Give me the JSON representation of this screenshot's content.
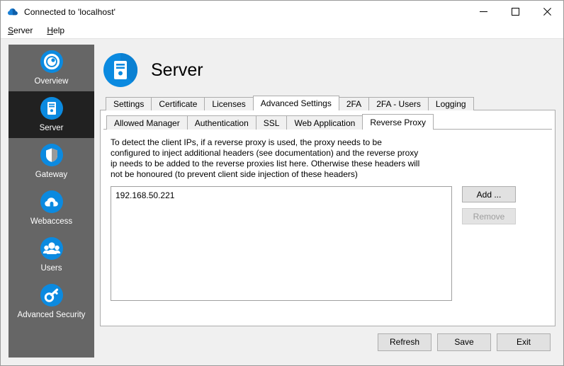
{
  "window": {
    "title": "Connected to 'localhost'",
    "title_icon": "cloud-icon",
    "controls": {
      "minimize": "minimize-icon",
      "maximize": "maximize-icon",
      "close": "close-icon"
    }
  },
  "menubar": {
    "items": [
      {
        "label": "Server",
        "mnemonic": "S",
        "rest": "erver"
      },
      {
        "label": "Help",
        "mnemonic": "H",
        "rest": "elp"
      }
    ]
  },
  "sidebar": {
    "items": [
      {
        "label": "Overview",
        "icon": "overview-circle-icon",
        "active": false
      },
      {
        "label": "Server",
        "icon": "server-tower-icon",
        "active": true
      },
      {
        "label": "Gateway",
        "icon": "shield-icon",
        "active": false
      },
      {
        "label": "Webaccess",
        "icon": "cloud-icon",
        "active": false
      },
      {
        "label": "Users",
        "icon": "users-icon",
        "active": false
      },
      {
        "label": "Advanced Security",
        "icon": "key-icon",
        "active": false
      }
    ]
  },
  "page": {
    "title": "Server",
    "icon": "server-tower-icon"
  },
  "tabs_primary": {
    "items": [
      {
        "label": "Settings",
        "selected": false
      },
      {
        "label": "Certificate",
        "selected": false
      },
      {
        "label": "Licenses",
        "selected": false
      },
      {
        "label": "Advanced Settings",
        "selected": true
      },
      {
        "label": "2FA",
        "selected": false
      },
      {
        "label": "2FA - Users",
        "selected": false
      },
      {
        "label": "Logging",
        "selected": false
      }
    ]
  },
  "tabs_secondary": {
    "items": [
      {
        "label": "Allowed Manager",
        "selected": false
      },
      {
        "label": "Authentication",
        "selected": false
      },
      {
        "label": "SSL",
        "selected": false
      },
      {
        "label": "Web Application",
        "selected": false
      },
      {
        "label": "Reverse Proxy",
        "selected": true
      }
    ]
  },
  "reverse_proxy": {
    "description_lines": [
      "To detect the client IPs, if a reverse proxy is used, the proxy needs to be",
      "configured to inject additional headers (see documentation) and the reverse proxy",
      "ip needs to be added to the reverse proxies list here. Otherwise these headers will",
      "not be honoured (to prevent client side injection of these headers)"
    ],
    "proxy_list": [
      "192.168.50.221"
    ],
    "add_button": "Add ...",
    "remove_button": "Remove",
    "remove_enabled": false
  },
  "footer": {
    "refresh_button": "Refresh",
    "save_button": "Save",
    "exit_button": "Exit"
  },
  "colors": {
    "accent": "#0b8ae0",
    "sidebar_bg": "#666666",
    "sidebar_active_bg": "#212121",
    "window_bg": "#f0f0f0"
  }
}
